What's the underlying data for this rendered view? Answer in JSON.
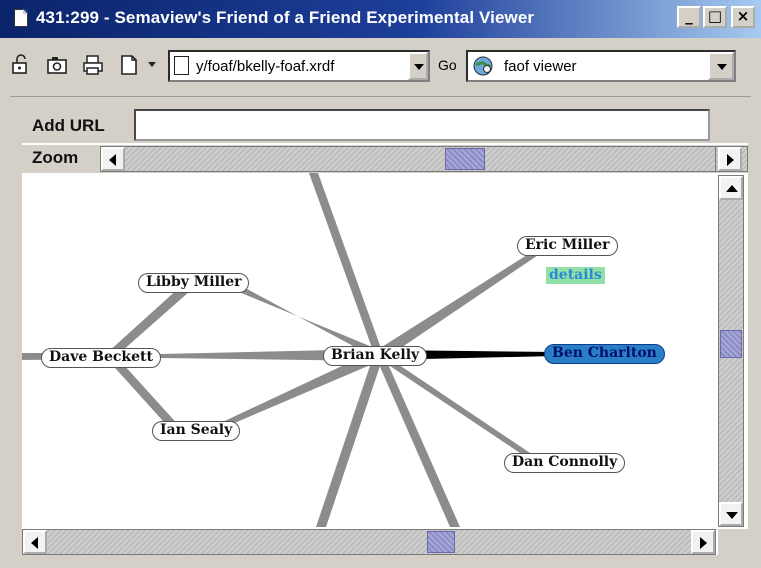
{
  "window": {
    "title": "431:299 - Semaview's Friend of a Friend Experimental Viewer",
    "min_glyph": "_",
    "max_glyph": "□",
    "close_glyph": "×"
  },
  "toolbar": {
    "url_value": "y/foaf/bkelly-foaf.xrdf",
    "go_label": "Go",
    "viewer_value": "faof viewer"
  },
  "applet": {
    "add_url_label": "Add URL",
    "add_url_value": "",
    "zoom_label": "Zoom",
    "zoom_level": 0.5
  },
  "graph": {
    "nodes": [
      {
        "name": "Brian Kelly",
        "selected": false
      },
      {
        "name": "Eric Miller",
        "selected": false
      },
      {
        "name": "Libby Miller",
        "selected": false
      },
      {
        "name": "Dave Beckett",
        "selected": false
      },
      {
        "name": "Ben Charlton",
        "selected": true
      },
      {
        "name": "Ian Sealy",
        "selected": false
      },
      {
        "name": "Dan Connolly",
        "selected": false
      }
    ],
    "details_label": "details",
    "colors": {
      "edge": "#8c8c8c",
      "selected_edge": "#000000",
      "selected_node": "#2a7ec6",
      "details_bg": "#90e0a8"
    }
  }
}
